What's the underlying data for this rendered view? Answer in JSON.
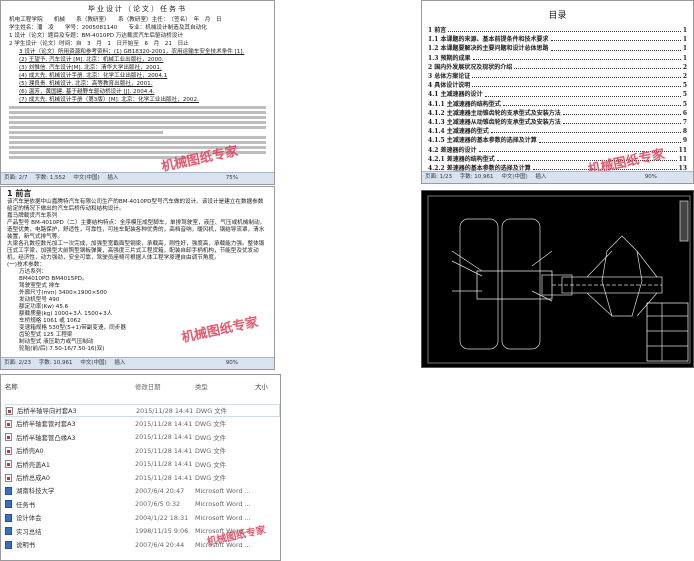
{
  "watermark": "机械图纸专家",
  "task_doc": {
    "title": "毕业设计（论文）任务书",
    "line1": "机电工程学院　　机械　　系（教研室）　　系（教研室）主任：　（签名）　年　月　日",
    "student": "学生姓名：潘　凌　　学号：2005081140　　专业：机械设计制造及其自动化",
    "topic": "1 设计（论文）题目及专题：BM-4010PD 万达载货汽车后驱动桥设计",
    "time": "2 学生设计（论文）时间：自　3　月　1　日开始至　6　月　21　日止",
    "refs": [
      "3 设计（论文）所用资源和参考资料：(1) GB18320-2001，农用运输车安全技术条件 [1].",
      "(2) 王望予. 汽车设计 [M]. 北京：机械工业出版社，2000.",
      "(3) 刘惟信. 汽车设计[M]. 北京：清华大学出版社，2001.",
      "(4) 成大先. 机械设计手册. 北京：化学工业出版社，2004.1",
      "(5) 濮良贵. 机械设计. 北京：高等教育出版社，2001.",
      "(6) 温芳，黄国建. 基于越野车驱动桥设计 [J]. 2004.4.",
      "(7) 成大先. 机械设计手册（第3版）[M]. 北京：化学工业出版社，2002."
    ],
    "status": {
      "page": "页面: 2/7",
      "words": "字数: 1,552",
      "lang": "中文(中国)",
      "mode": "插入",
      "zoom": "75%"
    }
  },
  "intro_doc": {
    "heading": "1 前言",
    "paragraphs": [
      "该汽车是依据中山嘉腾特汽车有限公司生产的BM-4010PD型号汽车做的设计。该设计是建立在数据参数给定的情况下做出的汽车后桥传动和结构设计。",
      "嘉马牌载货汽车系列",
      "产品型号 BM-4010PD（二）主要结构特点：全序模压成型脚车，单排驾驶室，液压、气压或机械制动，造型优美，电路保护，舒适性，可靠性，可挂车配装各种优秀的，高档音响，暖风机，钢结导流罩，清水装置，新气式排气等。",
      "大梁各孔数控数光加工一次完成，加强型宽截面型钢梁，承载高，刚性好，强度高，承载能力强。整体锻压式工字梁，加强型大前照型钢板弹簧，高强度三片式工程货箱，配装自卸手柄机构，节能型及优发动机，经济性，动力强劲，安全可靠，驾驶员座椅可根据人体工程学原理自由调节角度。"
    ],
    "spec_title": "(一)技术参数：",
    "specs": [
      "万达系列：",
      "BM4010PD BM4015PD。",
      "驾驶室型式 排车",
      "外廓尺寸(mm) 3400×1900×500",
      "发动机型号 490",
      "额定功率(Kw) 45.6",
      "额载质量(kg) 1000+3人 1500+3人",
      "车桥规格 1061 或 1062",
      "变速箱规格 530型(5+1)带副变速，同步器",
      "齿轮型式 125 工程梁",
      "制动型式 液压助力或气压制动",
      "轮胎(前/后) 7.50-16/7.50-16(双)"
    ],
    "status": {
      "page": "页面: 2/23",
      "words": "字数: 10,961",
      "lang": "中文(中国)",
      "mode": "插入",
      "zoom": "90%"
    }
  },
  "toc_doc": {
    "title": "目录",
    "entries": [
      {
        "t": "1 前言",
        "p": "1"
      },
      {
        "t": "1.1 本课题的来源、基本前提条件和技术要求",
        "p": "1"
      },
      {
        "t": "1.2 本课题要解决的主要问题和设计总体思路",
        "p": "1"
      },
      {
        "t": "1.3 预期的成果",
        "p": "1"
      },
      {
        "t": "2 国内外发展状况及现状的介绍",
        "p": "2"
      },
      {
        "t": "3 总体方案论证",
        "p": "2"
      },
      {
        "t": "4 具体设计说明",
        "p": "5"
      },
      {
        "t": "4.1 主减速器的设计",
        "p": "5"
      },
      {
        "t": "4.1.1 主减速器的结构型式",
        "p": "5"
      },
      {
        "t": "4.1.2 主减速器主动锥齿轮的支承型式及安装方法",
        "p": "6"
      },
      {
        "t": "4.1.3 主减速器从动锥齿轮的支承型式及安装方法",
        "p": "7"
      },
      {
        "t": "4.1.4 主减速器的型式",
        "p": "8"
      },
      {
        "t": "4.1.5 主减速器的基本参数的选择及计算",
        "p": "9"
      },
      {
        "t": "4.2 差速器的设计",
        "p": "11"
      },
      {
        "t": "4.2.1 差速器的结构型式",
        "p": "11"
      },
      {
        "t": "4.2.2 差速器的基本参数的选择及计算",
        "p": "13"
      },
      {
        "t": "4.3 半轴的设计",
        "p": "14"
      }
    ],
    "status": {
      "page": "页面: 1/23",
      "words": "字数: 10,961",
      "lang": "中文(中国)",
      "mode": "插入",
      "zoom": "90%"
    }
  },
  "file_list": {
    "columns": {
      "name": "名称",
      "date": "修改日期",
      "type": "类型",
      "size": "大小"
    },
    "files": [
      {
        "name": "后桥半轴导向衬套A3",
        "date": "2015/11/28 14:41",
        "type": "DWG 文件",
        "icon": "dwg"
      },
      {
        "name": "后桥半轴套管衬套A3",
        "date": "2015/11/28 14:41",
        "type": "DWG 文件",
        "icon": "dwg"
      },
      {
        "name": "后桥半轴套管凸缘A3",
        "date": "2015/11/28 14:41",
        "type": "DWG 文件",
        "icon": "dwg"
      },
      {
        "name": "后桥壳A0",
        "date": "2015/11/28 14:41",
        "type": "DWG 文件",
        "icon": "dwg"
      },
      {
        "name": "后桥壳盖A1",
        "date": "2015/11/28 14:41",
        "type": "DWG 文件",
        "icon": "dwg"
      },
      {
        "name": "后桥总成A0",
        "date": "2015/11/28 14:41",
        "type": "DWG 文件",
        "icon": "dwg"
      },
      {
        "name": "湖南科技大学",
        "date": "2007/6/4 20:47",
        "type": "Microsoft Word ...",
        "icon": "word"
      },
      {
        "name": "任务书",
        "date": "2007/6/5 0:32",
        "type": "Microsoft Word ...",
        "icon": "word"
      },
      {
        "name": "设计体会",
        "date": "2004/1/22 18:31",
        "type": "Microsoft Word ...",
        "icon": "word"
      },
      {
        "name": "实习总结",
        "date": "1998/11/15 9:06",
        "type": "Microsoft Word ...",
        "icon": "word"
      },
      {
        "name": "说明书",
        "date": "2007/6/4 20:44",
        "type": "Microsoft Word ...",
        "icon": "word"
      }
    ]
  }
}
